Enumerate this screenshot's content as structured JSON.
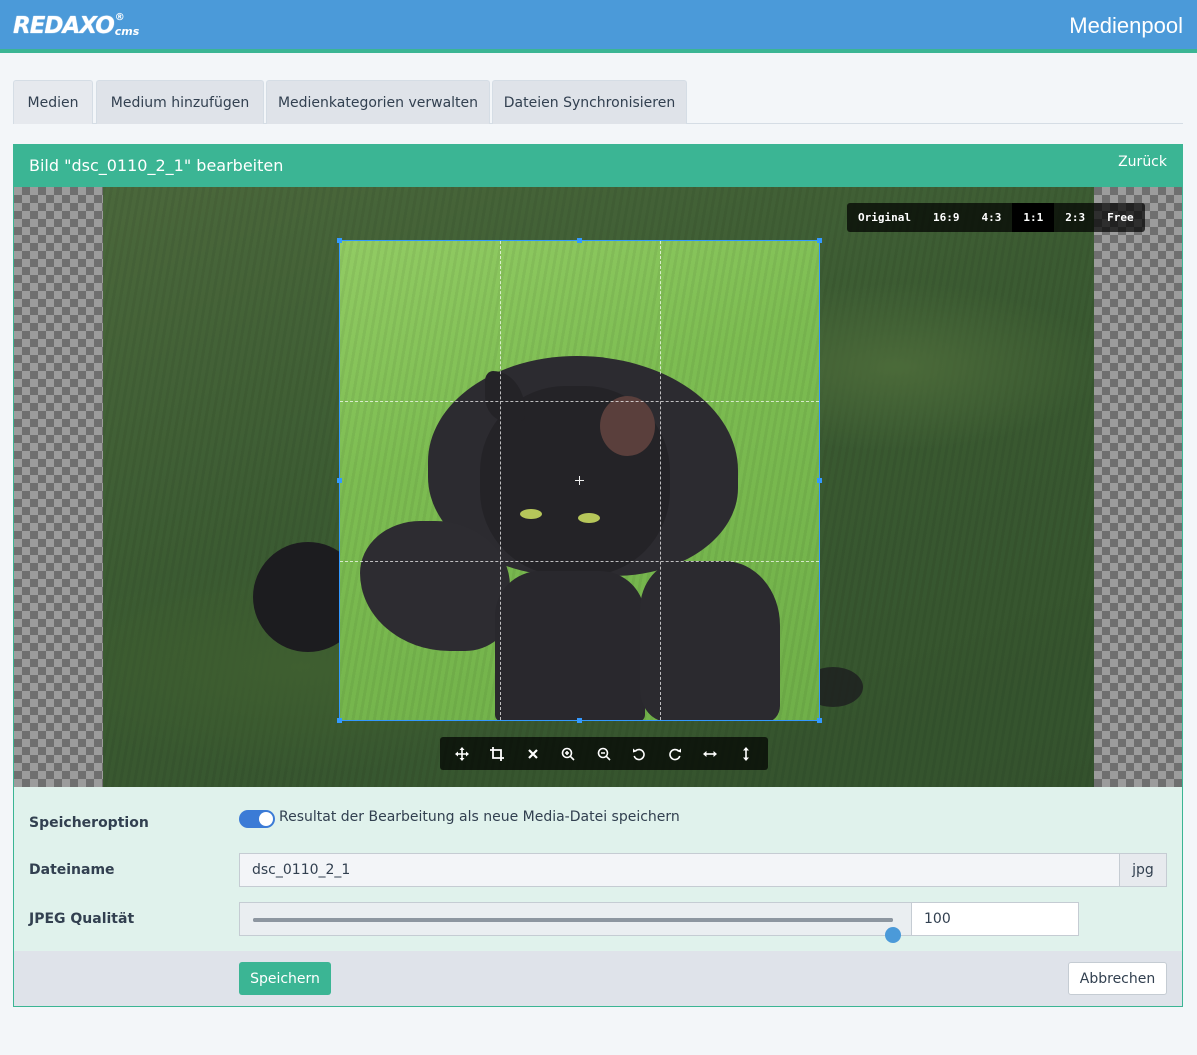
{
  "header": {
    "logo_text": "REDAXO",
    "logo_reg": "®",
    "logo_cms": "cms",
    "page_title": "Medienpool",
    "bar_color": "#4b9ad9",
    "accent_color": "#3bb594"
  },
  "tabs": [
    {
      "label": "Medien",
      "active": true
    },
    {
      "label": "Medium hinzufügen",
      "active": false
    },
    {
      "label": "Medienkategorien verwalten",
      "active": false
    },
    {
      "label": "Dateien Synchronisieren",
      "active": false
    }
  ],
  "panel": {
    "title": "Bild \"dsc_0110_2_1\" bearbeiten",
    "back_label": "Zurück"
  },
  "editor": {
    "ratios": [
      {
        "label": "Original",
        "active": false
      },
      {
        "label": "16:9",
        "active": false
      },
      {
        "label": "4:3",
        "active": false
      },
      {
        "label": "1:1",
        "active": true
      },
      {
        "label": "2:3",
        "active": false
      },
      {
        "label": "Free",
        "active": false
      }
    ],
    "tools": [
      "move-icon",
      "crop-icon",
      "clear-icon",
      "zoom-in-icon",
      "zoom-out-icon",
      "rotate-left-icon",
      "rotate-right-icon",
      "flip-horizontal-icon",
      "flip-vertical-icon"
    ]
  },
  "form": {
    "save_option_label": "Speicheroption",
    "save_option_text": "Resultat der Bearbeitung als neue Media-Datei speichern",
    "save_option_enabled": true,
    "filename_label": "Dateiname",
    "filename_value": "dsc_0110_2_1",
    "filename_ext": "jpg",
    "quality_label": "JPEG Qualität",
    "quality_value": "100",
    "quality_level": 1.0
  },
  "footer": {
    "save_label": "Speichern",
    "cancel_label": "Abbrechen"
  }
}
